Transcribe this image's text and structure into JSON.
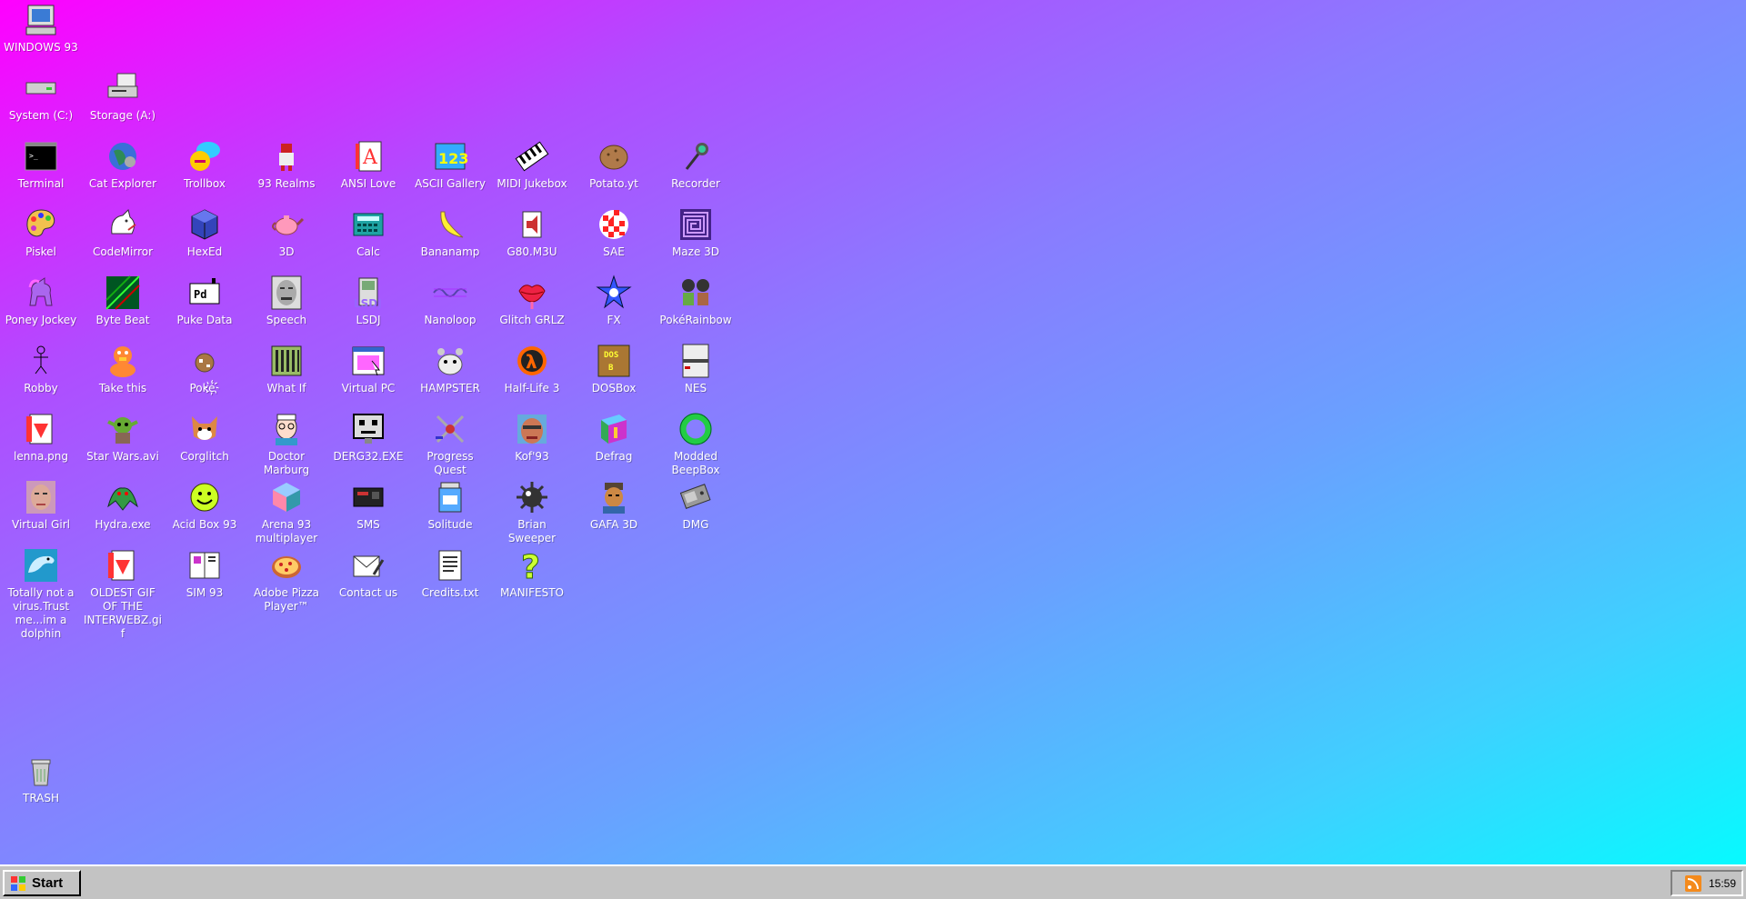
{
  "desktop": {
    "icons": [
      {
        "label": "WINDOWS 93",
        "icon": "computer-icon",
        "color": "#3a7bd5"
      },
      {
        "label": "System (C:)",
        "icon": "hard-drive-icon",
        "color": "#cfcfcf"
      },
      {
        "label": "Storage (A:)",
        "icon": "floppy-drive-icon",
        "color": "#cfcfcf"
      },
      {
        "label": "Terminal",
        "icon": "terminal-icon",
        "color": "#000000"
      },
      {
        "label": "Cat Explorer",
        "icon": "globe-cat-icon",
        "color": "#2e8b57"
      },
      {
        "label": "Trollbox",
        "icon": "chat-bubble-icon",
        "color": "#ff66cc"
      },
      {
        "label": "93 Realms",
        "icon": "warrior-icon",
        "color": "#cc2222"
      },
      {
        "label": "ANSI Love",
        "icon": "letter-a-icon",
        "color": "#ff3333"
      },
      {
        "label": "ASCII Gallery",
        "icon": "numbers-icon",
        "color": "#33aaff"
      },
      {
        "label": "MIDI Jukebox",
        "icon": "keyboard-icon",
        "color": "#222222"
      },
      {
        "label": "Potato.yt",
        "icon": "potato-icon",
        "color": "#b07a4a"
      },
      {
        "label": "Recorder",
        "icon": "microphone-icon",
        "color": "#33cc99"
      },
      {
        "label": "Piskel",
        "icon": "paint-palette-icon",
        "color": "#f2c14e"
      },
      {
        "label": "CodeMirror",
        "icon": "cat-icon",
        "color": "#ffffff"
      },
      {
        "label": "HexEd",
        "icon": "cube-icon",
        "color": "#2233aa"
      },
      {
        "label": "3D",
        "icon": "teapot-icon",
        "color": "#ff99bb"
      },
      {
        "label": "Calc",
        "icon": "calculator-icon",
        "color": "#1fa3a3"
      },
      {
        "label": "Bananamp",
        "icon": "banana-icon",
        "color": "#ffee33"
      },
      {
        "label": "G80.M3U",
        "icon": "speaker-icon",
        "color": "#ffffff"
      },
      {
        "label": "SAE",
        "icon": "amiga-ball-icon",
        "color": "#ff2222"
      },
      {
        "label": "Maze 3D",
        "icon": "maze-icon",
        "color": "#442288"
      },
      {
        "label": "Poney Jockey",
        "icon": "pony-icon",
        "color": "#aa66ee"
      },
      {
        "label": "Byte Beat",
        "icon": "byte-beat-icon",
        "color": "#116611"
      },
      {
        "label": "Puke Data",
        "icon": "puke-data-icon",
        "color": "#ffffff"
      },
      {
        "label": "Speech",
        "icon": "face-icon",
        "color": "#bbbbbb"
      },
      {
        "label": "LSDJ",
        "icon": "gameboy-icon",
        "color": "#9966ff"
      },
      {
        "label": "Nanoloop",
        "icon": "wave-icon",
        "color": "#5544aa"
      },
      {
        "label": "Glitch GRLZ",
        "icon": "lips-icon",
        "color": "#ee2244"
      },
      {
        "label": "FX",
        "icon": "fx-star-icon",
        "color": "#3355ff"
      },
      {
        "label": "PokéRainbow",
        "icon": "pokemon-icon",
        "color": "#336633"
      },
      {
        "label": "Robby",
        "icon": "stick-figure-icon",
        "color": "#ffffff"
      },
      {
        "label": "Take this",
        "icon": "duck-icon",
        "color": "#ff8833"
      },
      {
        "label": "Poké҉",
        "icon": "glitch-pokemon-icon",
        "color": "#aa7744"
      },
      {
        "label": "What If",
        "icon": "film-icon",
        "color": "#446622"
      },
      {
        "label": "Virtual PC",
        "icon": "window-icon",
        "color": "#3366cc"
      },
      {
        "label": "HAMPSTER",
        "icon": "hamster-icon",
        "color": "#dddddd"
      },
      {
        "label": "Half-Life 3",
        "icon": "lambda-icon",
        "color": "#ff6600"
      },
      {
        "label": "DOSBox",
        "icon": "dosbox-icon",
        "color": "#aa7733"
      },
      {
        "label": "NES",
        "icon": "nes-icon",
        "color": "#eeeeee"
      },
      {
        "label": "lenna.png",
        "icon": "image-file-icon",
        "color": "#ff3333"
      },
      {
        "label": "Star Wars.avi",
        "icon": "yoda-icon",
        "color": "#66aa33"
      },
      {
        "label": "Corglitch",
        "icon": "corgi-icon",
        "color": "#dd8844"
      },
      {
        "label": "Doctor Marburg",
        "icon": "doctor-icon",
        "color": "#ffddcc"
      },
      {
        "label": "DERG32.EXE",
        "icon": "robot-icon",
        "color": "#dddddd"
      },
      {
        "label": "Progress Quest",
        "icon": "crossed-swords-icon",
        "color": "#cc3333"
      },
      {
        "label": "Kof'93",
        "icon": "fighter-icon",
        "color": "#cc7755"
      },
      {
        "label": "Defrag",
        "icon": "defrag-icon",
        "color": "#33aa55"
      },
      {
        "label": "Modded BeepBox",
        "icon": "ring-icon",
        "color": "#22cc44"
      },
      {
        "label": "Virtual Girl",
        "icon": "portrait-icon",
        "color": "#ddaa99"
      },
      {
        "label": "Hydra.exe",
        "icon": "dragon-icon",
        "color": "#339944"
      },
      {
        "label": "Acid Box 93",
        "icon": "smiley-icon",
        "color": "#ccff22"
      },
      {
        "label": "Arena 93 multiplayer",
        "icon": "cube3d-icon",
        "color": "#ff88aa"
      },
      {
        "label": "SMS",
        "icon": "console-icon",
        "color": "#222222"
      },
      {
        "label": "Solitude",
        "icon": "jar-icon",
        "color": "#55aaff"
      },
      {
        "label": "Brian Sweeper",
        "icon": "mine-icon",
        "color": "#333333"
      },
      {
        "label": "GAFA 3D",
        "icon": "soldier-icon",
        "color": "#cc8844"
      },
      {
        "label": "DMG",
        "icon": "gameboy-gray-icon",
        "color": "#999999"
      },
      {
        "label": "Totally not a virus.Trust me...im a dolphin",
        "icon": "dolphin-icon",
        "color": "#44aacc"
      },
      {
        "label": "OLDEST GIF OF THE INTERWEBZ.gif",
        "icon": "gif-file-icon",
        "color": "#ff3333"
      },
      {
        "label": "SIM 93",
        "icon": "book-icon",
        "color": "#ffffff"
      },
      {
        "label": "Adobe Pizza Player™",
        "icon": "pizza-icon",
        "color": "#ffcc66"
      },
      {
        "label": "Contact us",
        "icon": "letter-icon",
        "color": "#ffffff"
      },
      {
        "label": "Credits.txt",
        "icon": "text-file-icon",
        "color": "#ffffff"
      },
      {
        "label": "MANIFESTO",
        "icon": "question-mark-icon",
        "color": "#ccff33"
      },
      {
        "label": "TRASH",
        "icon": "trash-icon",
        "color": "#cccccc"
      }
    ]
  },
  "taskbar": {
    "start_label": "Start",
    "clock": "15:59"
  }
}
